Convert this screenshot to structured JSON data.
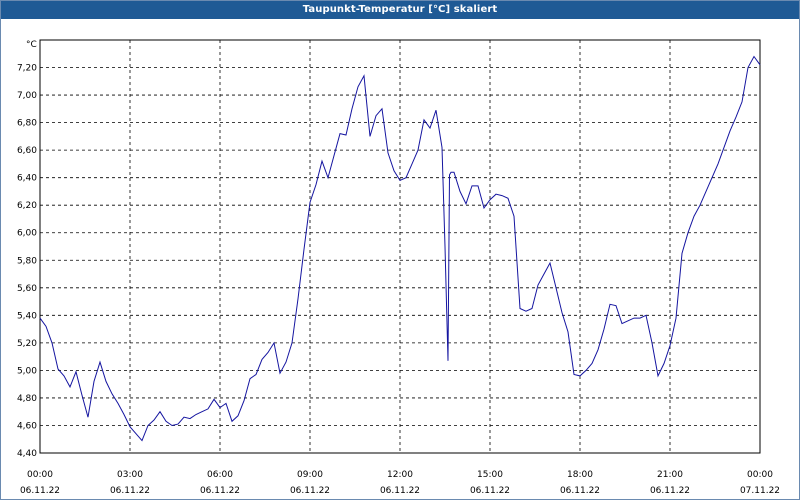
{
  "window": {
    "title": "Taupunkt-Temperatur [°C] skaliert"
  },
  "chart_data": {
    "type": "line",
    "title": "Taupunkt-Temperatur [°C] skaliert",
    "ylabel": "°C",
    "xlabel": "",
    "ylim": [
      4.4,
      7.4
    ],
    "xlim_hours": [
      0,
      24
    ],
    "grid": true,
    "line_color": "#1515a0",
    "y_ticks": [
      "4,40",
      "4,60",
      "4,80",
      "5,00",
      "5,20",
      "5,40",
      "5,60",
      "5,80",
      "6,00",
      "6,20",
      "6,40",
      "6,60",
      "6,80",
      "7,00",
      "7,20"
    ],
    "x_ticks": [
      {
        "time": "00:00",
        "date": "06.11.22"
      },
      {
        "time": "03:00",
        "date": "06.11.22"
      },
      {
        "time": "06:00",
        "date": "06.11.22"
      },
      {
        "time": "09:00",
        "date": "06.11.22"
      },
      {
        "time": "12:00",
        "date": "06.11.22"
      },
      {
        "time": "15:00",
        "date": "06.11.22"
      },
      {
        "time": "18:00",
        "date": "06.11.22"
      },
      {
        "time": "21:00",
        "date": "06.11.22"
      },
      {
        "time": "00:00",
        "date": "07.11.22"
      }
    ],
    "series": [
      {
        "x": [
          0,
          0.2,
          0.4,
          0.6,
          0.8,
          1.0,
          1.2,
          1.4,
          1.6,
          1.8,
          2.0,
          2.2,
          2.4,
          2.6,
          2.8,
          3.0,
          3.2,
          3.4,
          3.6,
          3.8,
          4.0,
          4.2,
          4.4,
          4.6,
          4.8,
          5.0,
          5.2,
          5.4,
          5.6,
          5.8,
          6.0,
          6.2,
          6.4,
          6.6,
          6.8,
          7.0,
          7.2,
          7.4,
          7.6,
          7.8,
          8.0,
          8.2,
          8.4,
          8.6,
          8.8,
          9.0,
          9.2,
          9.4,
          9.6,
          9.8,
          10.0,
          10.2,
          10.4,
          10.6,
          10.8,
          11.0,
          11.2,
          11.4,
          11.6,
          11.8,
          12.0,
          12.2,
          12.4,
          12.6,
          12.8,
          13.0,
          13.2,
          13.4,
          13.5,
          13.6,
          13.65,
          13.7,
          13.8,
          14.0,
          14.2,
          14.4,
          14.6,
          14.8,
          15.0,
          15.2,
          15.4,
          15.6,
          15.8,
          16.0,
          16.2,
          16.4,
          16.6,
          16.8,
          17.0,
          17.2,
          17.4,
          17.6,
          17.8,
          18.0,
          18.2,
          18.4,
          18.6,
          18.8,
          19.0,
          19.2,
          19.4,
          19.6,
          19.8,
          20.0,
          20.2,
          20.4,
          20.6,
          20.8,
          21.0,
          21.2,
          21.4,
          21.6,
          21.8,
          22.0,
          22.2,
          22.4,
          22.6,
          22.8,
          23.0,
          23.2,
          23.4,
          23.6,
          23.8,
          24.0
        ],
        "y": [
          5.38,
          5.32,
          5.2,
          5.01,
          4.96,
          4.88,
          4.99,
          4.82,
          4.66,
          4.92,
          5.06,
          4.92,
          4.83,
          4.76,
          4.68,
          4.59,
          4.54,
          4.49,
          4.6,
          4.64,
          4.7,
          4.63,
          4.6,
          4.61,
          4.66,
          4.65,
          4.68,
          4.7,
          4.72,
          4.79,
          4.73,
          4.76,
          4.63,
          4.67,
          4.78,
          4.94,
          4.97,
          5.08,
          5.13,
          5.2,
          4.98,
          5.06,
          5.2,
          5.52,
          5.88,
          6.22,
          6.35,
          6.52,
          6.4,
          6.56,
          6.72,
          6.71,
          6.9,
          7.06,
          7.14,
          6.7,
          6.85,
          6.9,
          6.58,
          6.45,
          6.38,
          6.4,
          6.5,
          6.6,
          6.82,
          6.76,
          6.89,
          6.62,
          5.9,
          5.07,
          6.42,
          6.44,
          6.44,
          6.3,
          6.21,
          6.34,
          6.34,
          6.18,
          6.24,
          6.28,
          6.27,
          6.25,
          6.12,
          5.45,
          5.43,
          5.45,
          5.62,
          5.7,
          5.78,
          5.6,
          5.42,
          5.28,
          4.97,
          4.96,
          5.0,
          5.05,
          5.15,
          5.3,
          5.48,
          5.47,
          5.34,
          5.36,
          5.38,
          5.38,
          5.4,
          5.2,
          4.96,
          5.05,
          5.18,
          5.38,
          5.85,
          6.0,
          6.12,
          6.2,
          6.3,
          6.4,
          6.5,
          6.62,
          6.74,
          6.84,
          6.95,
          7.2,
          7.28,
          7.22
        ]
      }
    ]
  }
}
